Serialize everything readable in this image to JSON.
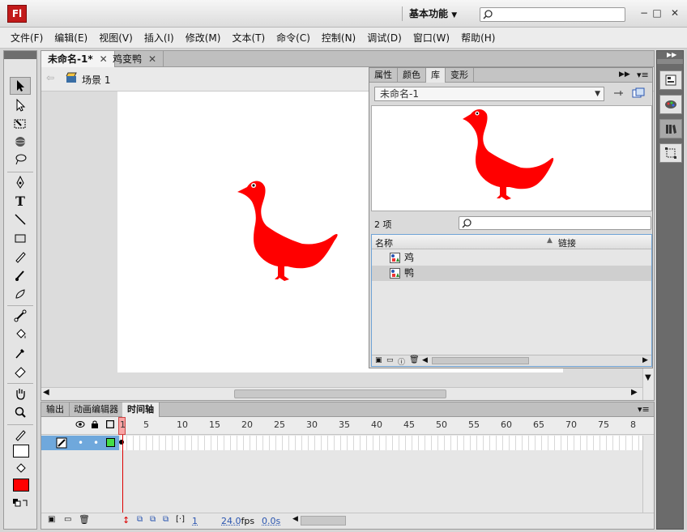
{
  "app": {
    "logo": "Fl",
    "workspace": "基本功能"
  },
  "menu": [
    "文件(F)",
    "编辑(E)",
    "视图(V)",
    "插入(I)",
    "修改(M)",
    "文本(T)",
    "命令(C)",
    "控制(N)",
    "调试(D)",
    "窗口(W)",
    "帮助(H)"
  ],
  "document": {
    "tabs": [
      "未命名-1*",
      "鸡变鸭"
    ],
    "scene": "场景 1"
  },
  "library": {
    "tabs": [
      "属性",
      "颜色",
      "库",
      "变形"
    ],
    "selected_doc": "未命名-1",
    "count": "2 项",
    "col_name": "名称",
    "col_link": "链接",
    "items": [
      {
        "name": "鸡"
      },
      {
        "name": "鸭"
      }
    ]
  },
  "timeline": {
    "tabs": [
      "输出",
      "动画编辑器",
      "时间轴"
    ],
    "ruler": [
      "1",
      "5",
      "10",
      "15",
      "20",
      "25",
      "30",
      "35",
      "40",
      "45",
      "50",
      "55",
      "60",
      "65",
      "70",
      "75",
      "8"
    ],
    "frame": "1",
    "fps": "24.0",
    "fps_unit": "fps",
    "time": "0.0s"
  },
  "colors": {
    "accent": "#ff0000",
    "stroke": "#ffffff",
    "fill": "#ff0000",
    "layer_highlight": "#6fa8dc"
  }
}
